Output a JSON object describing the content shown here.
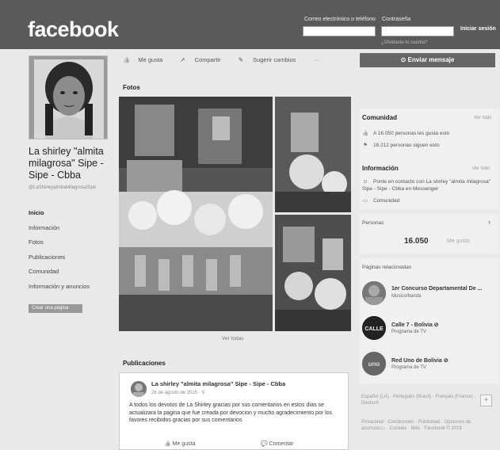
{
  "topbar": {
    "logo": "facebook",
    "email_label": "Correo electrónico o teléfono",
    "password_label": "Contraseña",
    "forgot_link": "¿Olvidaste tu cuenta?",
    "login_button": "Iniciar sesión"
  },
  "page": {
    "name": "La shirley \"almita milagrosa\" Sipe - Sipe - Cbba",
    "handle": "@LaShirleyalmitaMilagrosaSipe"
  },
  "nav": {
    "items": [
      "Inicio",
      "Información",
      "Fotos",
      "Publicaciones",
      "Comunidad",
      "Información y anuncios"
    ],
    "create_page": "Crear una página"
  },
  "actions": {
    "like": "Me gusta",
    "share": "Compartir",
    "suggest": "Sugerir cambios",
    "more": "···"
  },
  "photos": {
    "title": "Fotos",
    "see_all": "Ver todas"
  },
  "posts": {
    "title": "Publicaciones",
    "author": "La shirley \"almita milagrosa\" Sipe - Sipe - Cbba",
    "date": "26 de agosto de 2015 · ⚲",
    "text": "A todos los devotos de La Shirley gracias por sus comentarios en estos días se actualizara la pagina que fue creada por devocion y mucho agradecimiento por los favores recibidos gracias por sus comentarios",
    "like": "Me gusta",
    "comment": "Comentar"
  },
  "sidebar": {
    "send_message": "Enviar mensaje",
    "community_title": "Comunidad",
    "see_all": "Ver todo",
    "likes_text": "A 16.050 personas les gusta esto",
    "follows_text": "16.212 personas siguen esto",
    "info_title": "Información",
    "info_contact": "Ponte en contacto con La shirley \"almita milagrosa\" Sipe - Sipe - Cbba en Messenger",
    "info_category": "Comunidad",
    "people_title": "Personas",
    "people_count": "16.050",
    "people_sub": "Me gusta",
    "related_title": "Páginas relacionadas",
    "related": [
      {
        "name": "1er Concurso Departamental De ...",
        "category": "Músico/banda"
      },
      {
        "name": "Calle 7 - Bolivia ⊘",
        "category": "Programa de TV"
      },
      {
        "name": "Red Uno de Bolivia ⊘",
        "category": "Programa de TV"
      }
    ],
    "languages": "Español (LA) · Português (Brasil) · Français (France) · Deutsch",
    "footer_links": "Privacidad · Condiciones · Publicidad · Opciones de anuncios ▷ · Cookies · Más · Facebook © 2019"
  }
}
